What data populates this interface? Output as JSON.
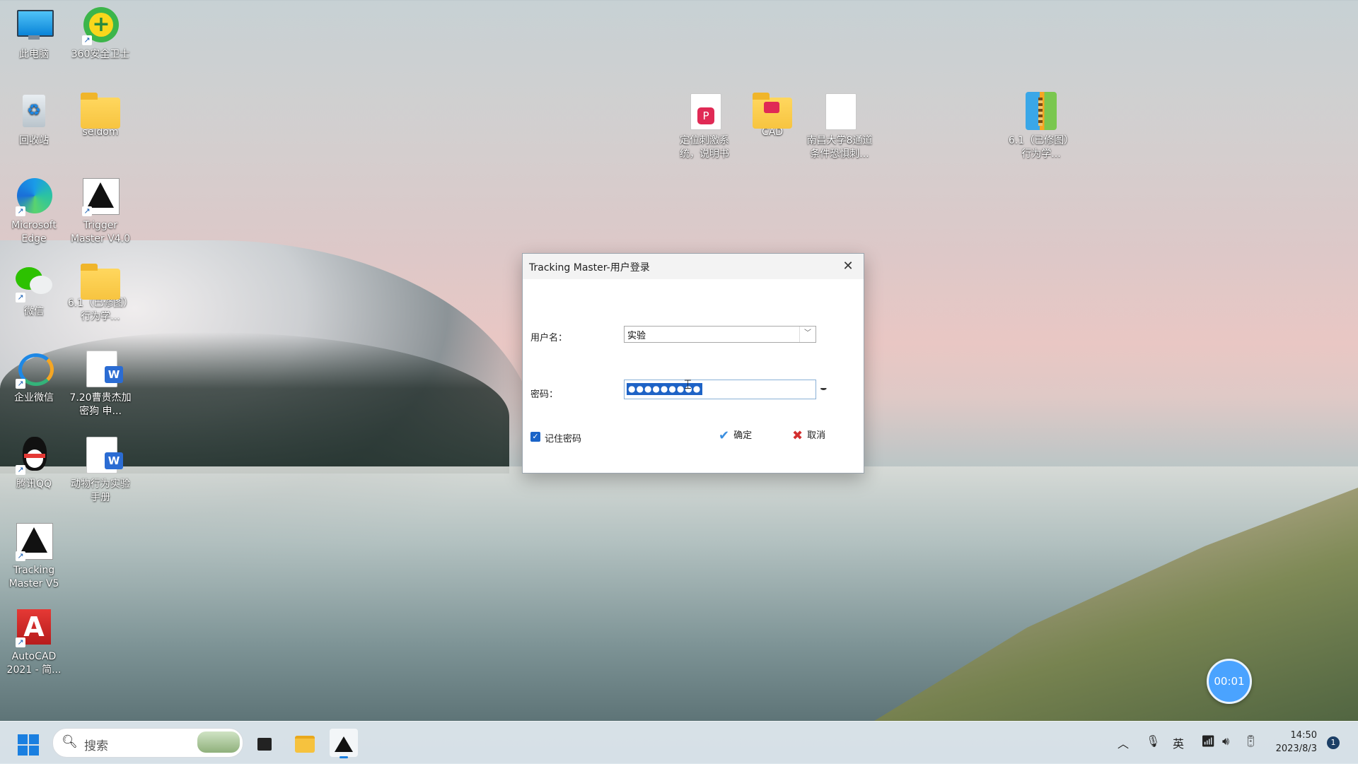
{
  "desktop": {
    "icons": [
      {
        "label": "此电脑",
        "icon": "computer-icon"
      },
      {
        "label": "360安全卫士",
        "icon": "360-icon"
      },
      {
        "label": "回收站",
        "icon": "recycle-bin-icon"
      },
      {
        "label": "seldom",
        "icon": "folder-icon"
      },
      {
        "label": "Microsoft Edge",
        "icon": "edge-icon"
      },
      {
        "label": "Trigger Master V4.0",
        "icon": "trigger-master-icon"
      },
      {
        "label": "微信",
        "icon": "wechat-icon"
      },
      {
        "label": "6.1（已修图）行为学...",
        "icon": "folder-icon"
      },
      {
        "label": "企业微信",
        "icon": "wecom-icon"
      },
      {
        "label": "7.20曹贵杰加密狗 申...",
        "icon": "word-doc-icon"
      },
      {
        "label": "腾讯QQ",
        "icon": "qq-icon"
      },
      {
        "label": "动物行为实验手册",
        "icon": "word-doc-icon"
      },
      {
        "label": "Tracking Master V5",
        "icon": "tracking-master-icon"
      },
      {
        "label": "AutoCAD 2021 - 简...",
        "icon": "autocad-icon"
      },
      {
        "label": "定位刺激系统，说明书",
        "icon": "pdf-doc-icon"
      },
      {
        "label": "CAD",
        "icon": "folder-icon"
      },
      {
        "label": "南昌大学8通道条件恐惧刺...",
        "icon": "blank-doc-icon"
      },
      {
        "label": "6.1（已修图）行为学...",
        "icon": "zip-icon"
      }
    ]
  },
  "dialog": {
    "title": "Tracking Master-用户登录",
    "username_label": "用户名：",
    "username_value": "实验",
    "password_label": "密码：",
    "password_value": "●●●●●●●●●",
    "remember_label": "记住密码",
    "remember_checked": true,
    "ok_label": "确定",
    "cancel_label": "取消"
  },
  "timer": "00:01",
  "taskbar": {
    "search_placeholder": "搜索",
    "ime": "英",
    "time": "14:50",
    "date": "2023/8/3",
    "notification_count": "1"
  }
}
